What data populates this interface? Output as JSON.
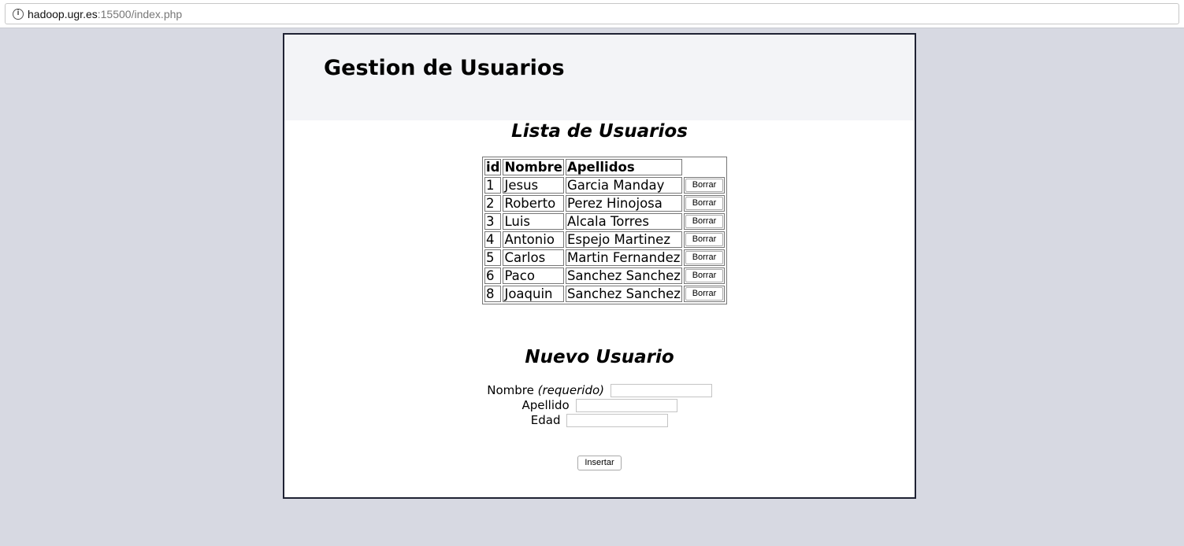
{
  "browser": {
    "url_host": "hadoop.ugr.es",
    "url_rest": ":15500/index.php",
    "info_icon_glyph": "i"
  },
  "page": {
    "title": "Gestion de Usuarios",
    "list_title": "Lista de Usuarios",
    "new_title": "Nuevo Usuario"
  },
  "table": {
    "headers": [
      "id",
      "Nombre",
      "Apellidos"
    ],
    "rows": [
      {
        "id": "1",
        "nombre": "Jesus",
        "apellidos": "Garcia Manday"
      },
      {
        "id": "2",
        "nombre": "Roberto",
        "apellidos": "Perez Hinojosa"
      },
      {
        "id": "3",
        "nombre": "Luis",
        "apellidos": "Alcala Torres"
      },
      {
        "id": "4",
        "nombre": "Antonio",
        "apellidos": "Espejo Martinez"
      },
      {
        "id": "5",
        "nombre": "Carlos",
        "apellidos": "Martin Fernandez"
      },
      {
        "id": "6",
        "nombre": "Paco",
        "apellidos": "Sanchez Sanchez"
      },
      {
        "id": "8",
        "nombre": "Joaquin",
        "apellidos": "Sanchez Sanchez"
      }
    ],
    "delete_label": "Borrar"
  },
  "form": {
    "nombre_label": "Nombre",
    "nombre_required": "(requerido)",
    "nombre_value": "",
    "apellido_label": "Apellido",
    "apellido_value": "",
    "edad_label": "Edad",
    "edad_value": "",
    "submit_label": "Insertar"
  }
}
